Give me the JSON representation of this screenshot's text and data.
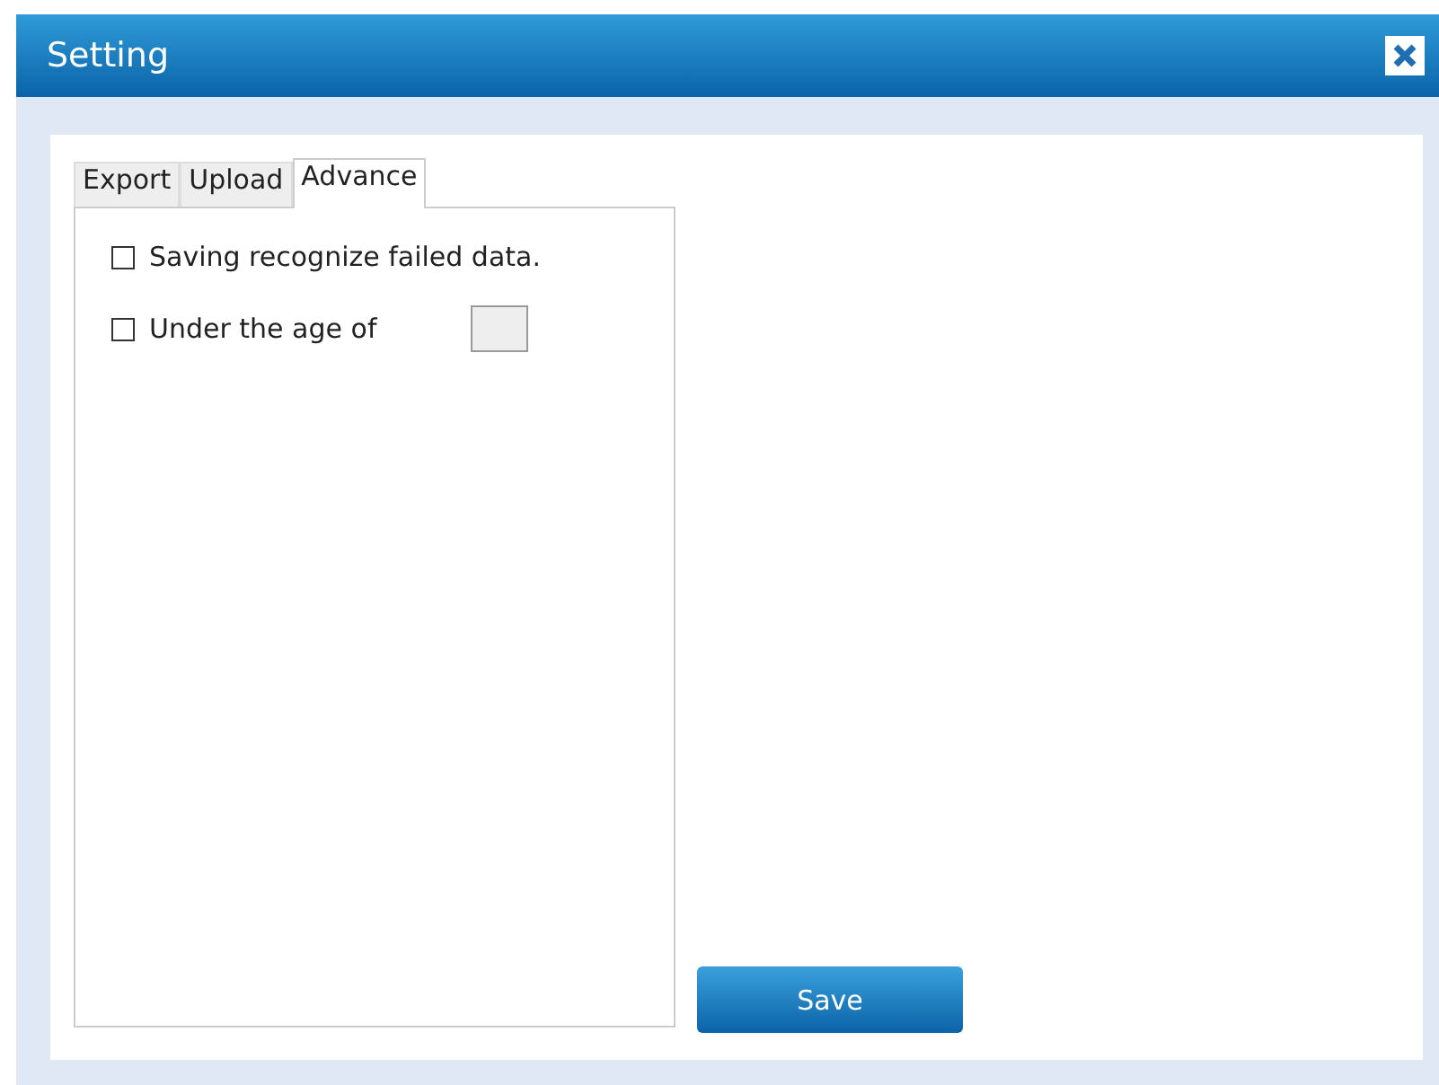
{
  "window": {
    "title": "Setting"
  },
  "tabs": [
    {
      "label": "Export",
      "selected": false
    },
    {
      "label": "Upload",
      "selected": false
    },
    {
      "label": "Advance",
      "selected": true
    }
  ],
  "options": [
    {
      "kind": "checkbox",
      "label": "Saving recognize failed data.",
      "checked": false
    },
    {
      "kind": "checkbox-field",
      "label": "Under the age of",
      "checked": false
    }
  ],
  "buttons": [
    {
      "label": "Save"
    }
  ]
}
